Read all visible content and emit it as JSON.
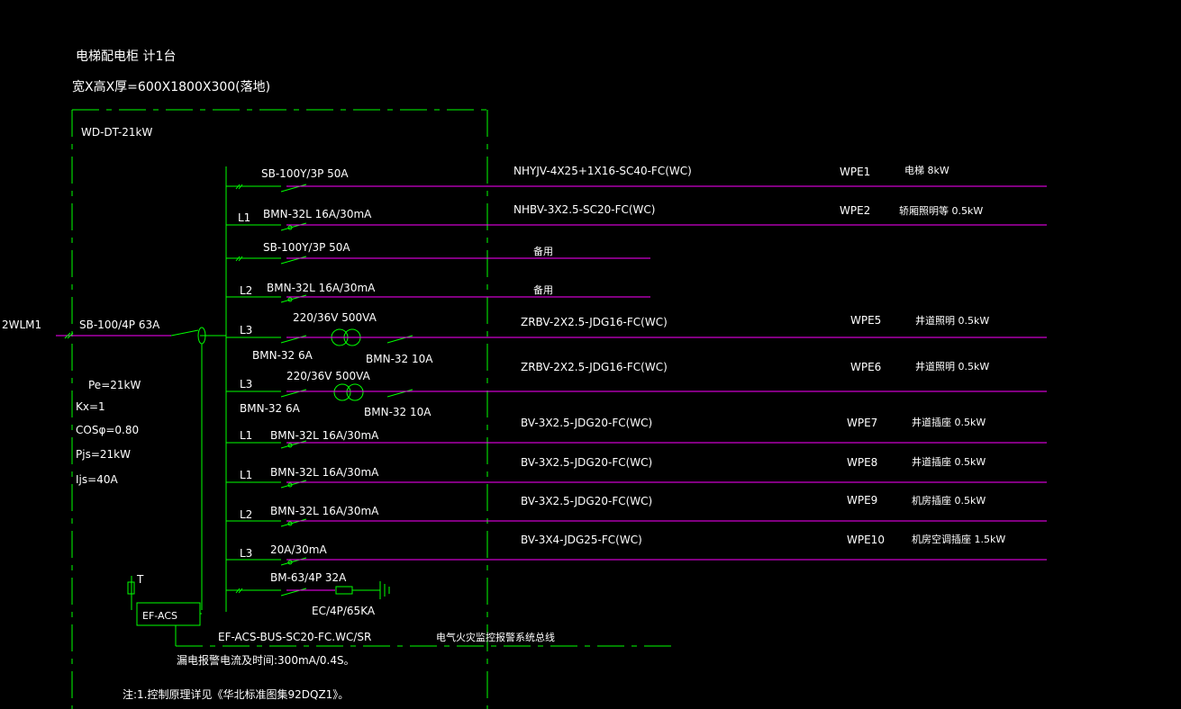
{
  "header": {
    "title": "电梯配电柜  计1台",
    "dims": "宽X高X厚=600X1800X300(落地)"
  },
  "cabinet": {
    "label": "WD-DT-21kW",
    "incoming": "2WLM1",
    "main_breaker": "SB-100/4P 63A",
    "params": [
      "Pe=21kW",
      "Kx=1",
      "COSφ=0.80",
      "Pjs=21kW",
      "Ijs=40A"
    ]
  },
  "circuits": [
    {
      "phase": "",
      "device": "SB-100Y/3P 50A",
      "cable": "NHYJV-4X25+1X16-SC40-FC(WC)",
      "id": "WPE1",
      "load": "电梯  8kW"
    },
    {
      "phase": "L1",
      "device": "BMN-32L 16A/30mA",
      "cable": "NHBV-3X2.5-SC20-FC(WC)",
      "id": "WPE2",
      "load": "轿厢照明等  0.5kW"
    },
    {
      "phase": "",
      "device": "SB-100Y/3P 50A",
      "cable": "",
      "id": "",
      "load": "备用"
    },
    {
      "phase": "L2",
      "device": "BMN-32L 16A/30mA",
      "cable": "",
      "id": "",
      "load": "备用"
    },
    {
      "phase": "L3",
      "device": "BMN-32 6A",
      "device2": "BMN-32 10A",
      "transformer": "220/36V 500VA",
      "cable": "ZRBV-2X2.5-JDG16-FC(WC)",
      "id": "WPE5",
      "load": "井道照明  0.5kW"
    },
    {
      "phase": "L3",
      "device": "BMN-32 6A",
      "device2": "BMN-32 10A",
      "transformer": "220/36V 500VA",
      "cable": "ZRBV-2X2.5-JDG16-FC(WC)",
      "id": "WPE6",
      "load": "井道照明  0.5kW"
    },
    {
      "phase": "L1",
      "device": "BMN-32L 16A/30mA",
      "cable": "BV-3X2.5-JDG20-FC(WC)",
      "id": "WPE7",
      "load": "井道插座  0.5kW"
    },
    {
      "phase": "L1",
      "device": "BMN-32L 16A/30mA",
      "cable": "BV-3X2.5-JDG20-FC(WC)",
      "id": "WPE8",
      "load": "井道插座  0.5kW"
    },
    {
      "phase": "L2",
      "device": "BMN-32L 16A/30mA",
      "cable": "BV-3X2.5-JDG20-FC(WC)",
      "id": "WPE9",
      "load": "机房插座   0.5kW"
    },
    {
      "phase": "L3",
      "device": "20A/30mA",
      "cable": "BV-3X4-JDG25-FC(WC)",
      "id": "WPE10",
      "load": "机房空调插座   1.5kW"
    },
    {
      "phase": "",
      "device": "BM-63/4P 32A",
      "spd": "EC/4P/65KA"
    }
  ],
  "fire_alarm": {
    "sensor": "T",
    "module": "EF-ACS",
    "bus": "EF-ACS-BUS-SC20-FC.WC/SR",
    "bus_desc": "电气火灾监控报警系统总线",
    "leakage": "漏电报警电流及时间:300mA/0.4S。"
  },
  "note": "注:1.控制原理详见《华北标准图集92DQZ1》。"
}
